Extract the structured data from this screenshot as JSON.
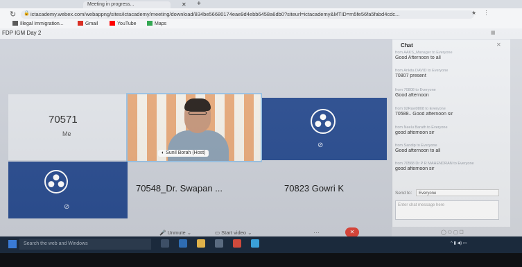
{
  "browser": {
    "tabs": [
      {
        "label": "Meeting in progress..."
      }
    ],
    "url": "ictacademy.webex.com/webappng/sites/ictacademy/meeting/download/834be56680174eae9d4ebb6458a6db0?siteurl=ictacademy&MTID=m5fe56fa5fabd4cdc...",
    "bookmarks": [
      {
        "label": "Illegal Immigration...",
        "icon": "bookmark-icon",
        "color": "#5b5b5b"
      },
      {
        "label": "Gmail",
        "icon": "gmail-icon",
        "color": "#d93025"
      },
      {
        "label": "YouTube",
        "icon": "youtube-icon",
        "color": "#ff0000"
      },
      {
        "label": "Maps",
        "icon": "maps-icon",
        "color": "#34a853"
      }
    ]
  },
  "meeting": {
    "title": "FDP IGM Day 2",
    "participants": {
      "self": {
        "id": "70571",
        "label": "Me"
      },
      "host": {
        "tag": "Sunil Borah (Host)"
      },
      "p3": {
        "name": "70548_Dr. Swapan ..."
      },
      "p4": {
        "name": "70823 Gowri K"
      }
    },
    "controls": {
      "unmute": "Unmute",
      "start_video": "Start video",
      "end_label": "✕"
    }
  },
  "chat": {
    "title": "Chat",
    "messages": [
      {
        "from": "from AAKS_Manager to Everyone",
        "text": "Good Afternoon to all"
      },
      {
        "from": "from Ankita DAVID to Everyone",
        "text": "70807 present"
      },
      {
        "from": "from 70808 to Everyone",
        "text": "Good afternoon"
      },
      {
        "from": "from 92Ravi0808 to Everyone",
        "text": "70588.. Good afternoon sir"
      },
      {
        "from": "from Neelu Barath to Everyone",
        "text": "good afternoon sir"
      },
      {
        "from": "from Sandip to Everyone",
        "text": "Good afternoon to all"
      },
      {
        "from": "from 70568 Dr P R MAHENDRAN to Everyone",
        "text": "good afternoon sir"
      }
    ],
    "send_to_label": "Send to:",
    "send_to_value": "Everyone",
    "input_placeholder": "Enter chat message here"
  },
  "taskbar": {
    "search_placeholder": "Search the web and Windows"
  }
}
